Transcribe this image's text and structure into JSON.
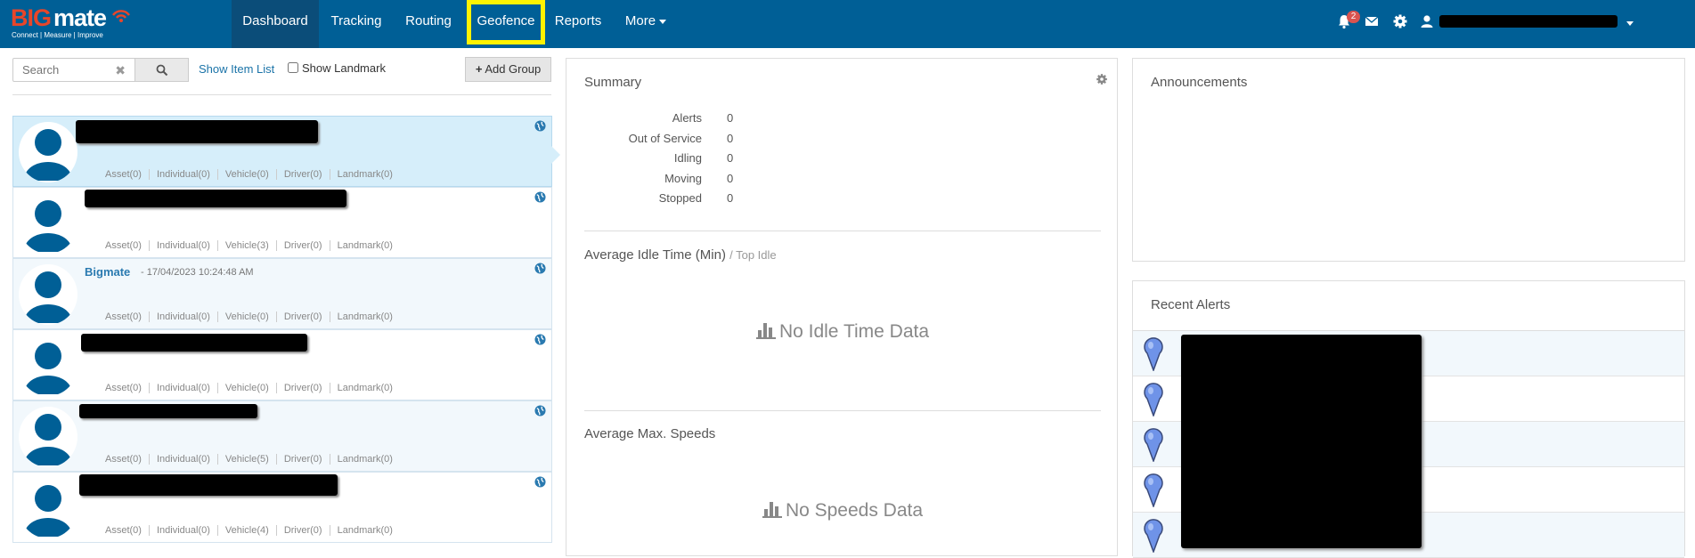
{
  "brand": {
    "logo_big": "BIG",
    "logo_mate": "mate",
    "tagline": "Connect | Measure | Improve"
  },
  "nav": {
    "items": [
      {
        "label": "Dashboard",
        "active": true
      },
      {
        "label": "Tracking"
      },
      {
        "label": "Routing"
      },
      {
        "label": "Geofence",
        "highlighted": true
      },
      {
        "label": "Reports"
      },
      {
        "label": "More"
      }
    ],
    "notifications_count": "2",
    "icons": [
      "bell-icon",
      "envelope-icon",
      "gear-icon",
      "user-icon"
    ]
  },
  "left": {
    "search_placeholder": "Search",
    "show_item_list": "Show Item List",
    "show_landmark": "Show Landmark",
    "add_group": "Add Group",
    "groups": [
      {
        "name": "",
        "date": "",
        "asset": "Asset(0)",
        "individual": "Individual(0)",
        "vehicle": "Vehicle(0)",
        "driver": "Driver(0)",
        "landmark": "Landmark(0)"
      },
      {
        "name": "",
        "date": "",
        "asset": "Asset(0)",
        "individual": "Individual(0)",
        "vehicle": "Vehicle(3)",
        "driver": "Driver(0)",
        "landmark": "Landmark(0)"
      },
      {
        "name": "Bigmate",
        "date": "- 17/04/2023 10:24:48 AM",
        "asset": "Asset(0)",
        "individual": "Individual(0)",
        "vehicle": "Vehicle(0)",
        "driver": "Driver(0)",
        "landmark": "Landmark(0)"
      },
      {
        "name": "",
        "date": "",
        "asset": "Asset(0)",
        "individual": "Individual(0)",
        "vehicle": "Vehicle(0)",
        "driver": "Driver(0)",
        "landmark": "Landmark(0)"
      },
      {
        "name": "",
        "date": "",
        "asset": "Asset(0)",
        "individual": "Individual(0)",
        "vehicle": "Vehicle(5)",
        "driver": "Driver(0)",
        "landmark": "Landmark(0)"
      },
      {
        "name": "",
        "date": "",
        "asset": "Asset(0)",
        "individual": "Individual(0)",
        "vehicle": "Vehicle(4)",
        "driver": "Driver(0)",
        "landmark": "Landmark(0)"
      }
    ]
  },
  "summary": {
    "title": "Summary",
    "rows": [
      {
        "label": "Alerts",
        "value": "0"
      },
      {
        "label": "Out of Service",
        "value": "0"
      },
      {
        "label": "Idling",
        "value": "0"
      },
      {
        "label": "Moving",
        "value": "0"
      },
      {
        "label": "Stopped",
        "value": "0"
      }
    ],
    "idle_title": "Average Idle Time (Min)",
    "idle_subtitle": "/ Top Idle",
    "idle_empty": "No Idle Time Data",
    "speed_title": "Average Max. Speeds",
    "speed_empty": "No Speeds Data"
  },
  "right": {
    "announcements_title": "Announcements",
    "recent_alerts_title": "Recent Alerts"
  },
  "colors": {
    "navbar": "#005f96",
    "active_nav": "#0b4d79",
    "highlight": "#fff200",
    "link": "#1a73a8",
    "pin": "#6f93e8"
  }
}
